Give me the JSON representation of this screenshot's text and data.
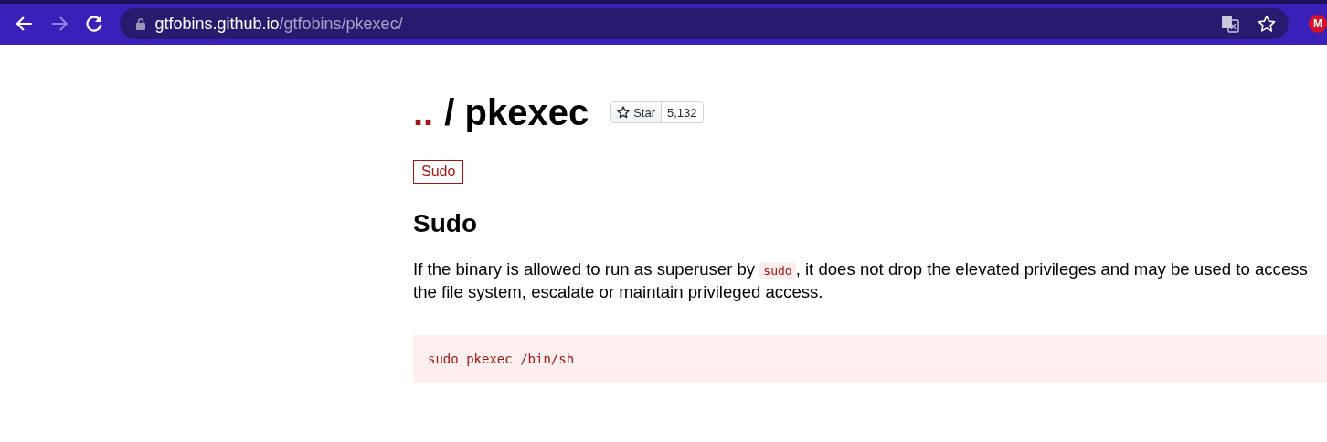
{
  "browser": {
    "url_host": "gtfobins.github.io",
    "url_path": "/gtfobins/pkexec/",
    "extension_badge": "M"
  },
  "page": {
    "breadcrumb_link": "..",
    "title": "/ pkexec",
    "star_button": {
      "label": "Star",
      "count": "5,132"
    },
    "tags": [
      "Sudo"
    ],
    "sections": [
      {
        "heading": "Sudo",
        "paragraph": {
          "before": "If the binary is allowed to run as superuser by ",
          "code": "sudo",
          "after": ", it does not drop the elevated privileges and may be used to access the file system, escalate or maintain privileged access."
        },
        "code_block": "sudo pkexec /bin/sh"
      }
    ]
  }
}
